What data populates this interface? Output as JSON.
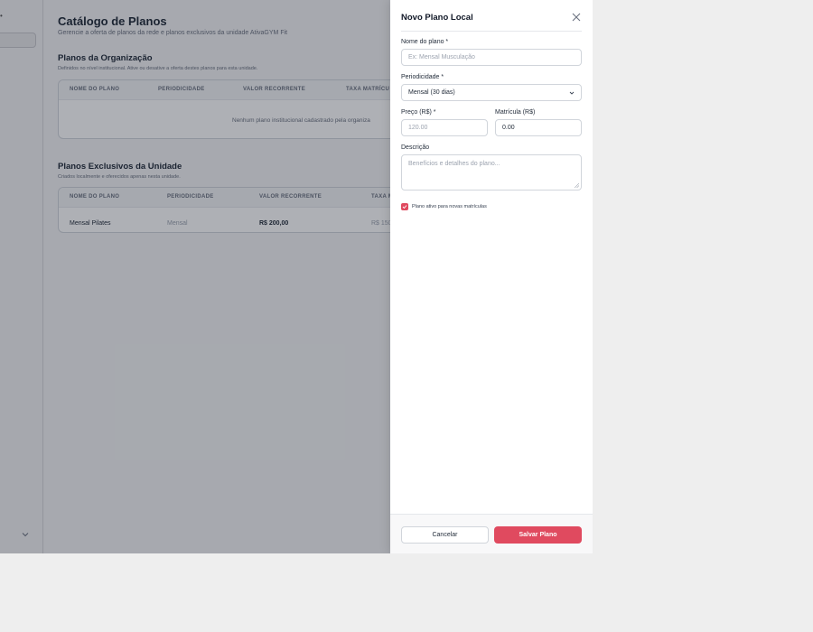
{
  "page": {
    "title": "Catálogo de Planos",
    "subtitle": "Gerencie a oferta de planos da rede e planos exclusivos da unidade AtivaGYM Fit"
  },
  "org_section": {
    "title": "Planos da Organização",
    "subtitle": "Definidos no nível institucional. Ative ou desative a oferta destes planos para esta unidade.",
    "columns": [
      "NOME DO PLANO",
      "PERIODICIDADE",
      "VALOR RECORRENTE",
      "TAXA MATRÍCU"
    ],
    "empty_text": "Nenhum plano institucional cadastrado pela organiza"
  },
  "unit_section": {
    "title": "Planos Exclusivos da Unidade",
    "subtitle": "Criados localmente e oferecidos apenas nesta unidade.",
    "columns": [
      "NOME DO PLANO",
      "PERIODICIDADE",
      "VALOR RECORRENTE",
      "TAXA M"
    ],
    "rows": [
      {
        "name": "Mensal Pilates",
        "period": "Mensal",
        "value": "R$ 200,00",
        "fee": "R$ 150"
      }
    ]
  },
  "drawer": {
    "title": "Novo Plano Local",
    "name_label": "Nome do plano *",
    "name_placeholder": "Ex: Mensal Musculação",
    "period_label": "Periodicidade *",
    "period_value": "Mensal (30 dias)",
    "price_label": "Preço (R$) *",
    "price_placeholder": "120.00",
    "enroll_label": "Matrícula (R$)",
    "enroll_value": "0.00",
    "desc_label": "Descrição",
    "desc_placeholder": "Benefícios e detalhes do plano...",
    "active_label": "Plano ativo para novas matrículas",
    "cancel_label": "Cancelar",
    "save_label": "Salvar Plano"
  },
  "colors": {
    "accent": "#e04a5f",
    "overlay": "#111827"
  }
}
